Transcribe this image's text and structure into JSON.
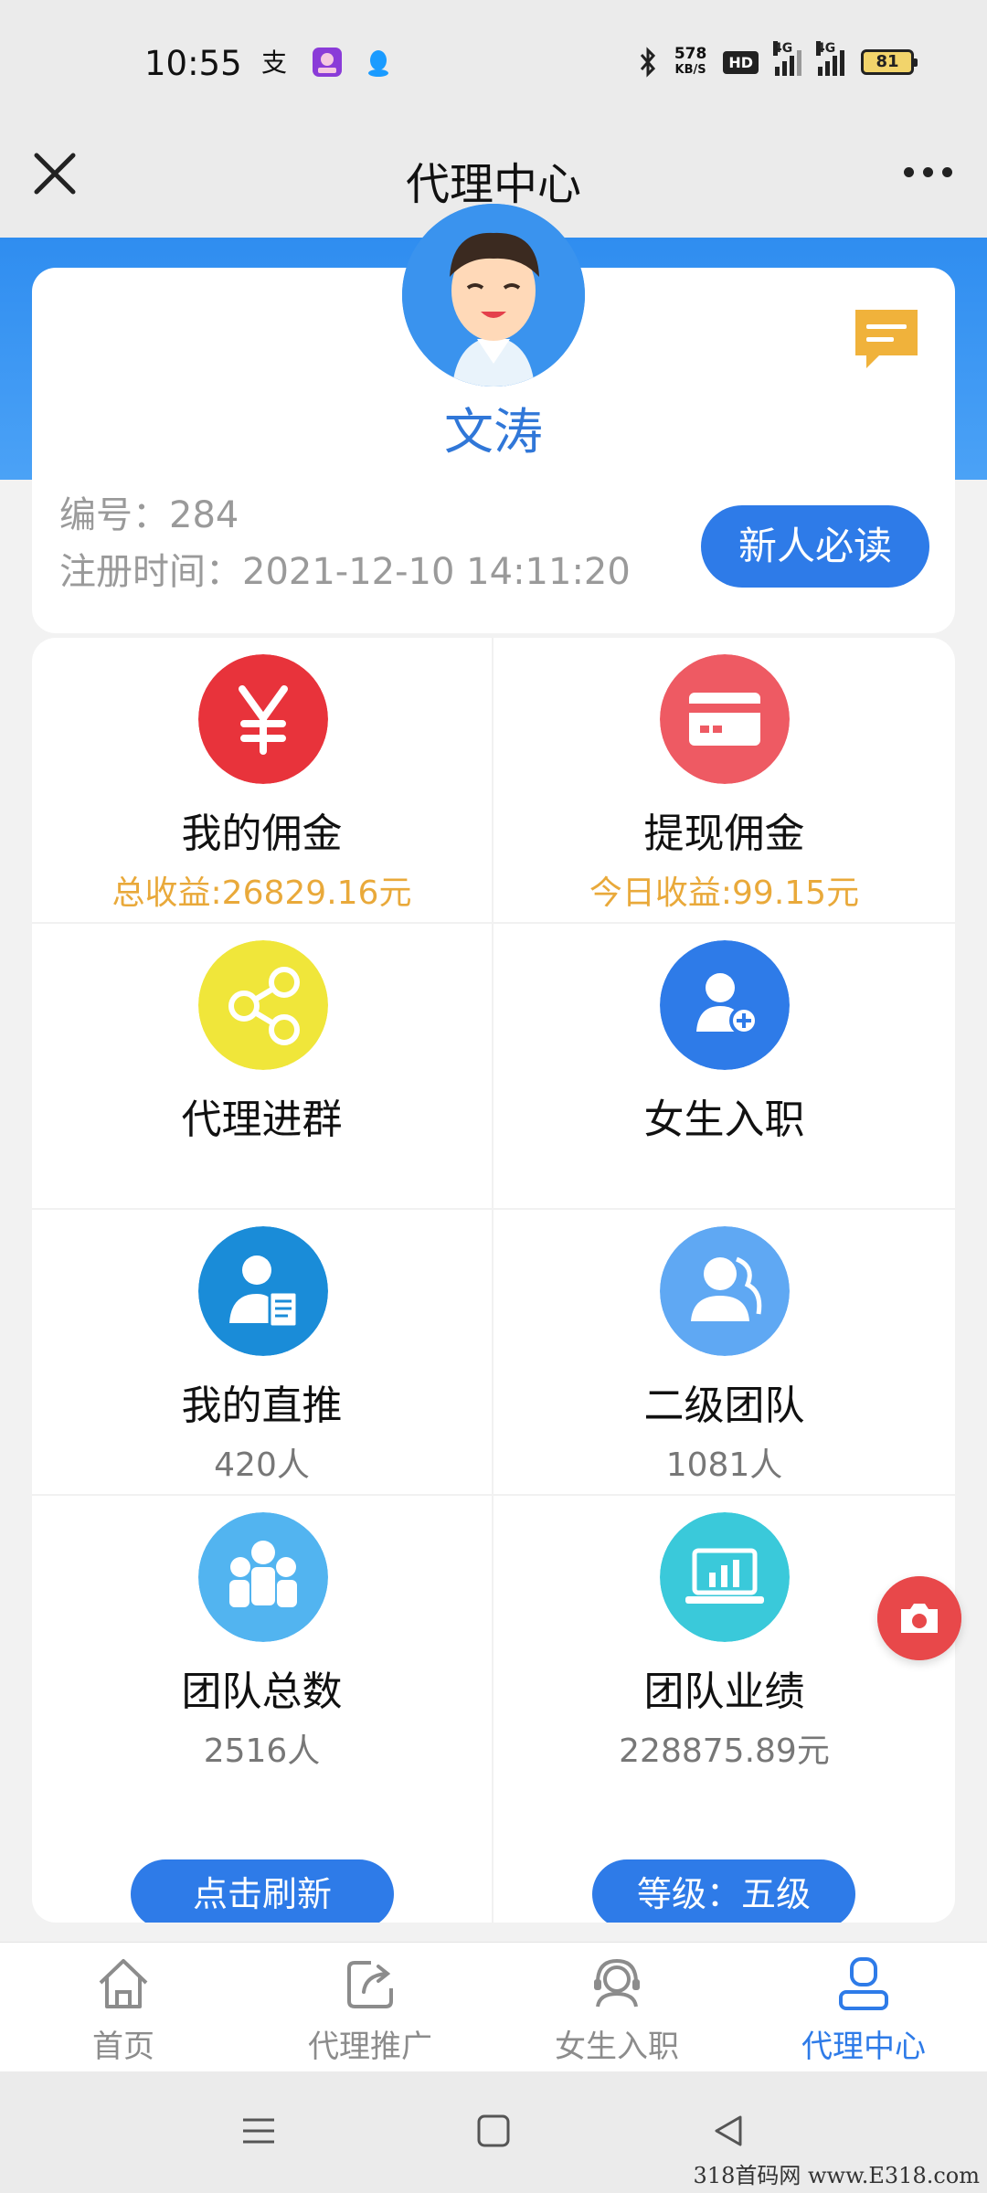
{
  "status_bar": {
    "time": "10:55",
    "net_speed_value": "578",
    "net_speed_unit": "KB/S",
    "hd_label": "HD",
    "signal1_label": "4G",
    "signal2_label": "4G",
    "battery": "81"
  },
  "nav": {
    "title": "代理中心"
  },
  "profile": {
    "name": "文涛",
    "id_line": "编号：284",
    "register_line": "注册时间：2021-12-10 14:11:20",
    "newbie_button": "新人必读"
  },
  "grid": {
    "commission_title": "我的佣金",
    "commission_sub": "总收益:26829.16元",
    "withdraw_title": "提现佣金",
    "withdraw_sub": "今日收益:99.15元",
    "group_title": "代理进群",
    "hire_title": "女生入职",
    "direct_title": "我的直推",
    "direct_sub": "420人",
    "level2_title": "二级团队",
    "level2_sub": "1081人",
    "team_total_title": "团队总数",
    "team_total_sub": "2516人",
    "team_perf_title": "团队业绩",
    "team_perf_sub": "228875.89元",
    "refresh_button": "点击刷新",
    "level_button": "等级：五级"
  },
  "tabs": [
    {
      "label": "首页",
      "icon": "home-icon"
    },
    {
      "label": "代理推广",
      "icon": "share-icon"
    },
    {
      "label": "女生入职",
      "icon": "headset-icon"
    },
    {
      "label": "代理中心",
      "icon": "user-icon"
    }
  ],
  "watermark": "318首码网 www.E318.com",
  "colors": {
    "accent": "#2e7be8",
    "banner": "#2f8df0",
    "gold": "#e9a93a",
    "red": "#e8333b"
  }
}
